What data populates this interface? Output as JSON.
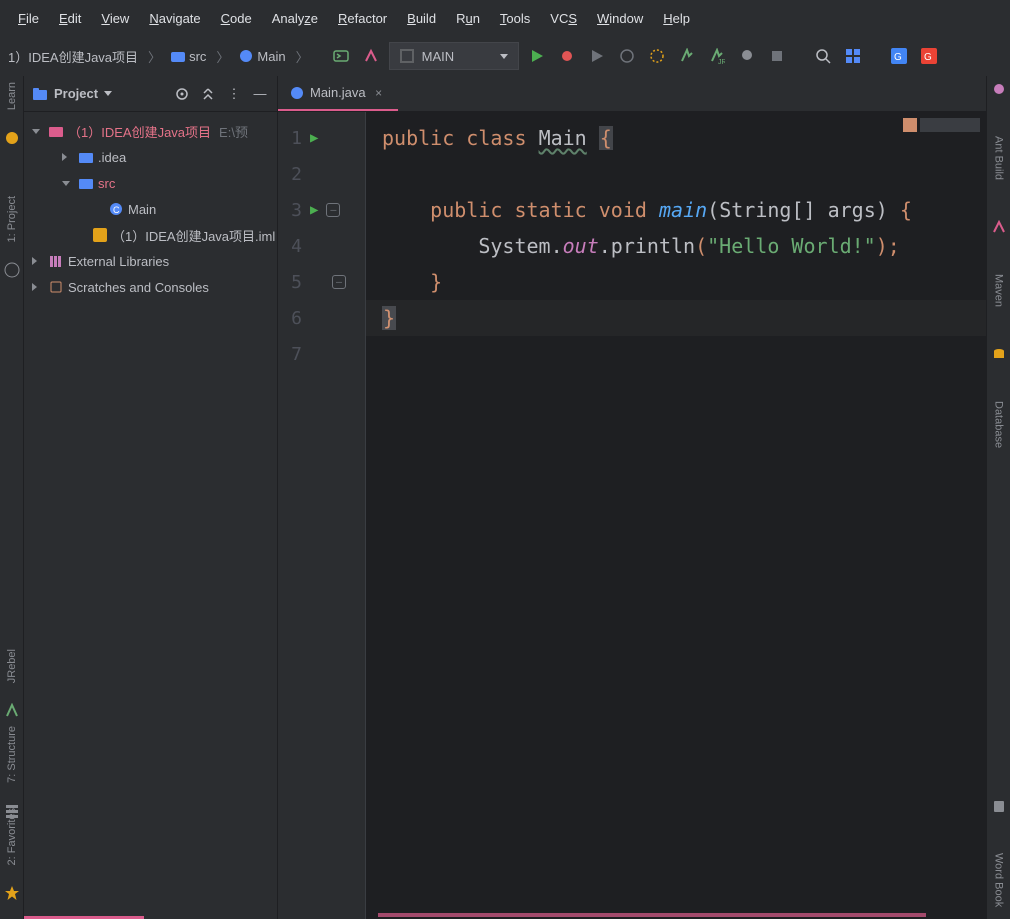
{
  "menubar": [
    "File",
    "Edit",
    "View",
    "Navigate",
    "Code",
    "Analyze",
    "Refactor",
    "Build",
    "Run",
    "Tools",
    "VCS",
    "Window",
    "Help"
  ],
  "breadcrumbs": {
    "project": "1）IDEA创建Java项目",
    "src": "src",
    "class": "Main"
  },
  "run_config": {
    "label": "MAIN"
  },
  "project_panel": {
    "title": "Project",
    "root": "（1）IDEA创建Java项目",
    "root_path": "E:\\预",
    "idea_folder": ".idea",
    "src_folder": "src",
    "main_class": "Main",
    "iml_file": "（1）IDEA创建Java项目.iml",
    "external_libs": "External Libraries",
    "scratches": "Scratches and Consoles"
  },
  "tab": {
    "filename": "Main.java"
  },
  "code": {
    "line1_kw1": "public",
    "line1_kw2": "class",
    "line1_name": "Main",
    "line1_brace": "{",
    "line3_kw1": "public",
    "line3_kw2": "static",
    "line3_kw3": "void",
    "line3_fn": "main",
    "line3_args": "(String[] args)",
    "line3_brace": "{",
    "line4_sys": "System.",
    "line4_out": "out",
    "line4_dot": ".",
    "line4_println": "println",
    "line4_open": "(",
    "line4_str": "\"Hello World!\"",
    "line4_close": ");",
    "line5_brace": "}",
    "line6_brace": "}",
    "line_numbers": [
      "1",
      "2",
      "3",
      "4",
      "5",
      "6",
      "7"
    ]
  },
  "left_tools": {
    "learn": "Learn",
    "project": "1: Project",
    "jrebel": "JRebel",
    "structure": "7: Structure",
    "favorites": "2: Favorites"
  },
  "right_tools": {
    "ant": "Ant Build",
    "maven": "Maven",
    "database": "Database",
    "wordbook": "Word Book"
  }
}
